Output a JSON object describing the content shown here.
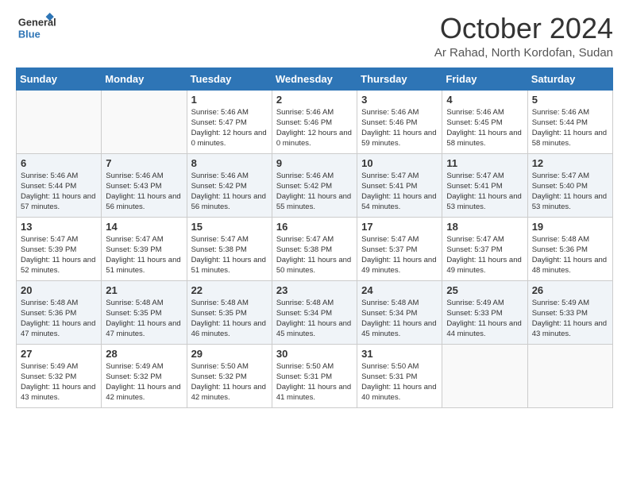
{
  "logo": {
    "text_general": "General",
    "text_blue": "Blue"
  },
  "header": {
    "title": "October 2024",
    "subtitle": "Ar Rahad, North Kordofan, Sudan"
  },
  "weekdays": [
    "Sunday",
    "Monday",
    "Tuesday",
    "Wednesday",
    "Thursday",
    "Friday",
    "Saturday"
  ],
  "weeks": [
    [
      {
        "day": "",
        "sunrise": "",
        "sunset": "",
        "daylight": ""
      },
      {
        "day": "",
        "sunrise": "",
        "sunset": "",
        "daylight": ""
      },
      {
        "day": "1",
        "sunrise": "Sunrise: 5:46 AM",
        "sunset": "Sunset: 5:47 PM",
        "daylight": "Daylight: 12 hours and 0 minutes."
      },
      {
        "day": "2",
        "sunrise": "Sunrise: 5:46 AM",
        "sunset": "Sunset: 5:46 PM",
        "daylight": "Daylight: 12 hours and 0 minutes."
      },
      {
        "day": "3",
        "sunrise": "Sunrise: 5:46 AM",
        "sunset": "Sunset: 5:46 PM",
        "daylight": "Daylight: 11 hours and 59 minutes."
      },
      {
        "day": "4",
        "sunrise": "Sunrise: 5:46 AM",
        "sunset": "Sunset: 5:45 PM",
        "daylight": "Daylight: 11 hours and 58 minutes."
      },
      {
        "day": "5",
        "sunrise": "Sunrise: 5:46 AM",
        "sunset": "Sunset: 5:44 PM",
        "daylight": "Daylight: 11 hours and 58 minutes."
      }
    ],
    [
      {
        "day": "6",
        "sunrise": "Sunrise: 5:46 AM",
        "sunset": "Sunset: 5:44 PM",
        "daylight": "Daylight: 11 hours and 57 minutes."
      },
      {
        "day": "7",
        "sunrise": "Sunrise: 5:46 AM",
        "sunset": "Sunset: 5:43 PM",
        "daylight": "Daylight: 11 hours and 56 minutes."
      },
      {
        "day": "8",
        "sunrise": "Sunrise: 5:46 AM",
        "sunset": "Sunset: 5:42 PM",
        "daylight": "Daylight: 11 hours and 56 minutes."
      },
      {
        "day": "9",
        "sunrise": "Sunrise: 5:46 AM",
        "sunset": "Sunset: 5:42 PM",
        "daylight": "Daylight: 11 hours and 55 minutes."
      },
      {
        "day": "10",
        "sunrise": "Sunrise: 5:47 AM",
        "sunset": "Sunset: 5:41 PM",
        "daylight": "Daylight: 11 hours and 54 minutes."
      },
      {
        "day": "11",
        "sunrise": "Sunrise: 5:47 AM",
        "sunset": "Sunset: 5:41 PM",
        "daylight": "Daylight: 11 hours and 53 minutes."
      },
      {
        "day": "12",
        "sunrise": "Sunrise: 5:47 AM",
        "sunset": "Sunset: 5:40 PM",
        "daylight": "Daylight: 11 hours and 53 minutes."
      }
    ],
    [
      {
        "day": "13",
        "sunrise": "Sunrise: 5:47 AM",
        "sunset": "Sunset: 5:39 PM",
        "daylight": "Daylight: 11 hours and 52 minutes."
      },
      {
        "day": "14",
        "sunrise": "Sunrise: 5:47 AM",
        "sunset": "Sunset: 5:39 PM",
        "daylight": "Daylight: 11 hours and 51 minutes."
      },
      {
        "day": "15",
        "sunrise": "Sunrise: 5:47 AM",
        "sunset": "Sunset: 5:38 PM",
        "daylight": "Daylight: 11 hours and 51 minutes."
      },
      {
        "day": "16",
        "sunrise": "Sunrise: 5:47 AM",
        "sunset": "Sunset: 5:38 PM",
        "daylight": "Daylight: 11 hours and 50 minutes."
      },
      {
        "day": "17",
        "sunrise": "Sunrise: 5:47 AM",
        "sunset": "Sunset: 5:37 PM",
        "daylight": "Daylight: 11 hours and 49 minutes."
      },
      {
        "day": "18",
        "sunrise": "Sunrise: 5:47 AM",
        "sunset": "Sunset: 5:37 PM",
        "daylight": "Daylight: 11 hours and 49 minutes."
      },
      {
        "day": "19",
        "sunrise": "Sunrise: 5:48 AM",
        "sunset": "Sunset: 5:36 PM",
        "daylight": "Daylight: 11 hours and 48 minutes."
      }
    ],
    [
      {
        "day": "20",
        "sunrise": "Sunrise: 5:48 AM",
        "sunset": "Sunset: 5:36 PM",
        "daylight": "Daylight: 11 hours and 47 minutes."
      },
      {
        "day": "21",
        "sunrise": "Sunrise: 5:48 AM",
        "sunset": "Sunset: 5:35 PM",
        "daylight": "Daylight: 11 hours and 47 minutes."
      },
      {
        "day": "22",
        "sunrise": "Sunrise: 5:48 AM",
        "sunset": "Sunset: 5:35 PM",
        "daylight": "Daylight: 11 hours and 46 minutes."
      },
      {
        "day": "23",
        "sunrise": "Sunrise: 5:48 AM",
        "sunset": "Sunset: 5:34 PM",
        "daylight": "Daylight: 11 hours and 45 minutes."
      },
      {
        "day": "24",
        "sunrise": "Sunrise: 5:48 AM",
        "sunset": "Sunset: 5:34 PM",
        "daylight": "Daylight: 11 hours and 45 minutes."
      },
      {
        "day": "25",
        "sunrise": "Sunrise: 5:49 AM",
        "sunset": "Sunset: 5:33 PM",
        "daylight": "Daylight: 11 hours and 44 minutes."
      },
      {
        "day": "26",
        "sunrise": "Sunrise: 5:49 AM",
        "sunset": "Sunset: 5:33 PM",
        "daylight": "Daylight: 11 hours and 43 minutes."
      }
    ],
    [
      {
        "day": "27",
        "sunrise": "Sunrise: 5:49 AM",
        "sunset": "Sunset: 5:32 PM",
        "daylight": "Daylight: 11 hours and 43 minutes."
      },
      {
        "day": "28",
        "sunrise": "Sunrise: 5:49 AM",
        "sunset": "Sunset: 5:32 PM",
        "daylight": "Daylight: 11 hours and 42 minutes."
      },
      {
        "day": "29",
        "sunrise": "Sunrise: 5:50 AM",
        "sunset": "Sunset: 5:32 PM",
        "daylight": "Daylight: 11 hours and 42 minutes."
      },
      {
        "day": "30",
        "sunrise": "Sunrise: 5:50 AM",
        "sunset": "Sunset: 5:31 PM",
        "daylight": "Daylight: 11 hours and 41 minutes."
      },
      {
        "day": "31",
        "sunrise": "Sunrise: 5:50 AM",
        "sunset": "Sunset: 5:31 PM",
        "daylight": "Daylight: 11 hours and 40 minutes."
      },
      {
        "day": "",
        "sunrise": "",
        "sunset": "",
        "daylight": ""
      },
      {
        "day": "",
        "sunrise": "",
        "sunset": "",
        "daylight": ""
      }
    ]
  ]
}
